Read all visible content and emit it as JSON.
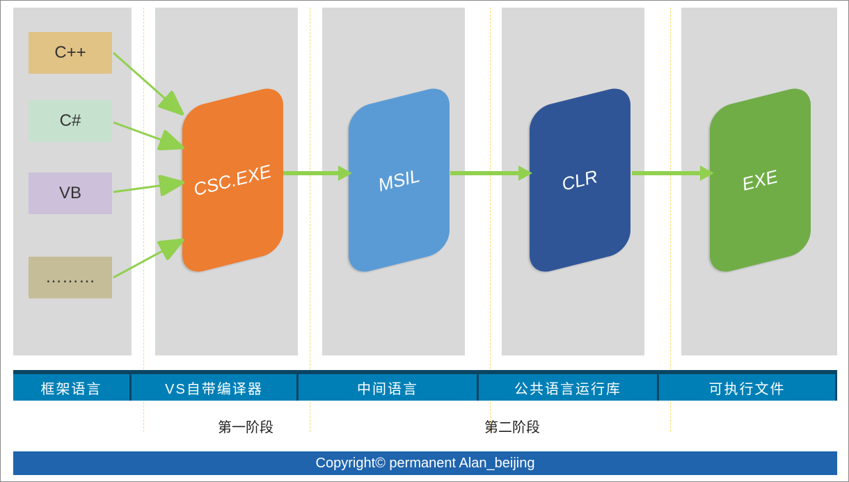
{
  "languages": [
    {
      "label": "C++",
      "bg": "#e1c386"
    },
    {
      "label": "C#",
      "bg": "#c6e2cf"
    },
    {
      "label": "VB",
      "bg": "#ccc0da"
    },
    {
      "label": "………",
      "bg": "#c4bd97"
    }
  ],
  "stages": [
    {
      "label": "CSC.EXE",
      "bg": "#ed7d31"
    },
    {
      "label": "MSIL",
      "bg": "#5b9bd5"
    },
    {
      "label": "CLR",
      "bg": "#2f5597"
    },
    {
      "label": "EXE",
      "bg": "#70ad47"
    }
  ],
  "column_labels": [
    "框架语言",
    "VS自带编译器",
    "中间语言",
    "公共语言运行库",
    "可执行文件"
  ],
  "phase_labels": [
    "第一阶段",
    "第二阶段"
  ],
  "footer": "Copyright©  permanent   Alan_beijing"
}
